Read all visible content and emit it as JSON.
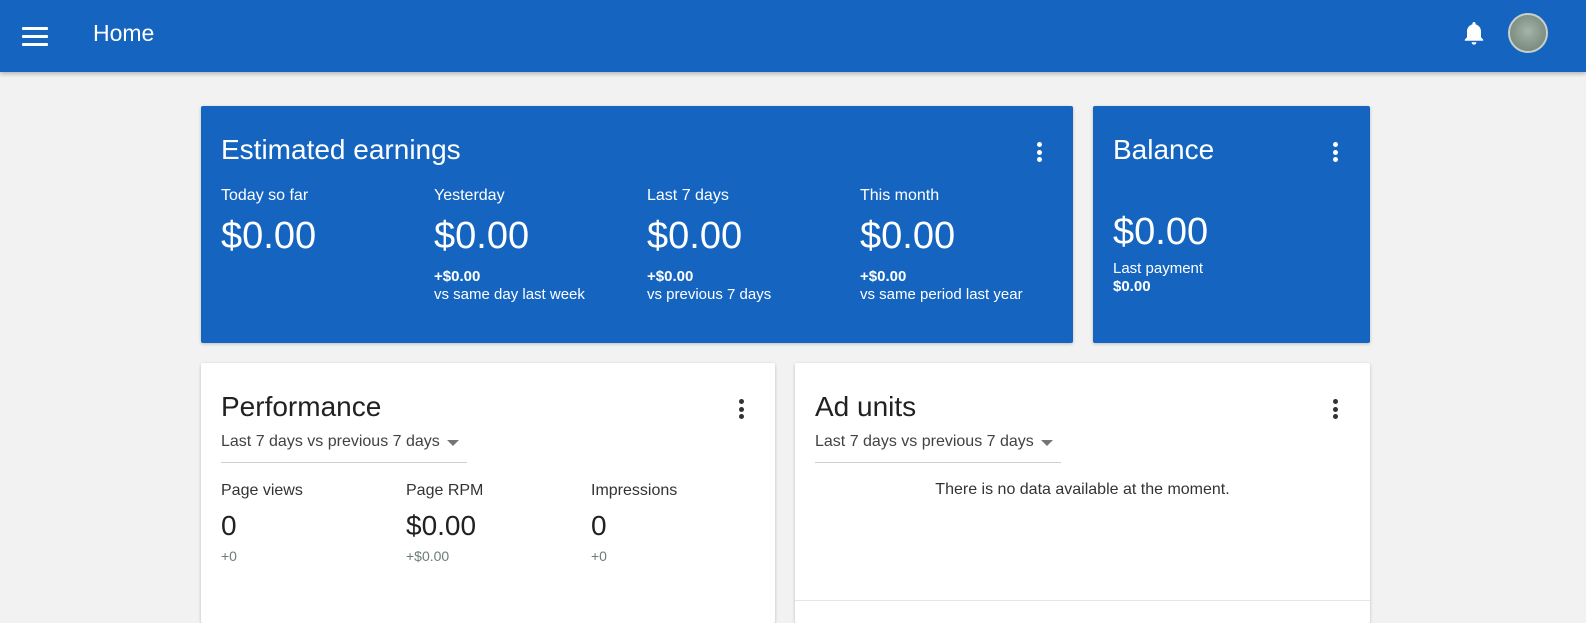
{
  "header": {
    "title": "Home",
    "menu_icon": "menu-icon",
    "bell_icon": "bell-icon",
    "avatar_icon": "avatar-icon"
  },
  "colors": {
    "primary": "#1565c0",
    "background": "#f2f2f2",
    "card_white": "#ffffff",
    "delta_muted": "#6b7d75"
  },
  "earnings": {
    "title": "Estimated earnings",
    "metrics": [
      {
        "label": "Today so far",
        "value": "$0.00",
        "delta": "",
        "comparison": ""
      },
      {
        "label": "Yesterday",
        "value": "$0.00",
        "delta": "+$0.00",
        "comparison": "vs same day last week"
      },
      {
        "label": "Last 7 days",
        "value": "$0.00",
        "delta": "+$0.00",
        "comparison": "vs previous 7 days"
      },
      {
        "label": "This month",
        "value": "$0.00",
        "delta": "+$0.00",
        "comparison": "vs same period last year"
      }
    ]
  },
  "balance": {
    "title": "Balance",
    "value": "$0.00",
    "last_payment_label": "Last payment",
    "last_payment_value": "$0.00"
  },
  "performance": {
    "title": "Performance",
    "range": "Last 7 days vs previous 7 days",
    "metrics": [
      {
        "label": "Page views",
        "value": "0",
        "delta": "+0"
      },
      {
        "label": "Page RPM",
        "value": "$0.00",
        "delta": "+$0.00"
      },
      {
        "label": "Impressions",
        "value": "0",
        "delta": "+0"
      }
    ]
  },
  "ad_units": {
    "title": "Ad units",
    "range": "Last 7 days vs previous 7 days",
    "empty_message": "There is no data available at the moment."
  }
}
